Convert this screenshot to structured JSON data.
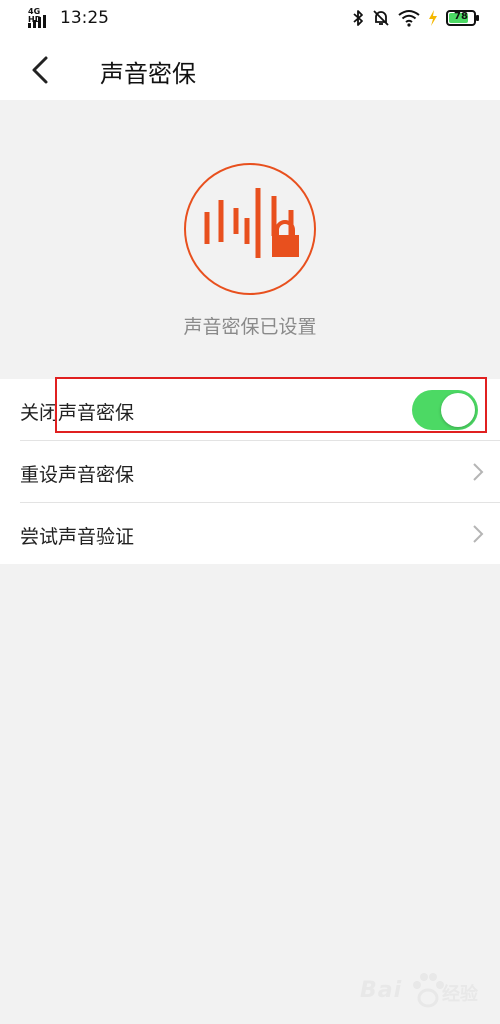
{
  "status_bar": {
    "network": "4G HD",
    "time": "13:25",
    "battery": "78",
    "battery_level_percent": 78,
    "battery_color": "#4cd964",
    "icons": [
      "bluetooth-icon",
      "mute-icon",
      "wifi-icon",
      "charging-icon"
    ]
  },
  "header": {
    "back_icon": "chevron-left-icon",
    "title": "声音密保"
  },
  "hero": {
    "icon": "voice-lock-icon",
    "accent_color": "#e8501e",
    "status_text": "声音密保已设置"
  },
  "settings": {
    "items": [
      {
        "label": "关闭声音密保",
        "control": "toggle",
        "toggle_on": true,
        "toggle_color": "#4cd964"
      },
      {
        "label": "重设声音密保",
        "control": "chevron"
      },
      {
        "label": "尝试声音验证",
        "control": "chevron"
      }
    ]
  },
  "annotation": {
    "highlight_color": "#e02020"
  },
  "watermark": {
    "brand": "Bai",
    "suffix": "经验"
  }
}
